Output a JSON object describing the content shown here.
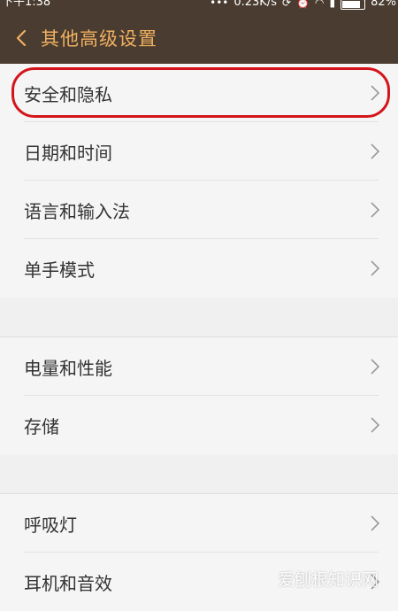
{
  "status_bar": {
    "time": "下午1:38",
    "network_speed": "0.23K/s",
    "battery_percent": "82%"
  },
  "header": {
    "back_icon": "chevron-left-icon",
    "title": "其他高级设置"
  },
  "sections": [
    {
      "items": [
        {
          "label": "安全和隐私"
        },
        {
          "label": "日期和时间"
        },
        {
          "label": "语言和输入法"
        },
        {
          "label": "单手模式"
        }
      ]
    },
    {
      "items": [
        {
          "label": "电量和性能"
        },
        {
          "label": "存储"
        }
      ]
    },
    {
      "items": [
        {
          "label": "呼吸灯"
        },
        {
          "label": "耳机和音效"
        }
      ]
    }
  ],
  "watermark": "爱刨根知识网",
  "colors": {
    "header_bg": "#4a3c30",
    "title_color": "#f0b060",
    "highlight_ring": "#d3141b"
  }
}
